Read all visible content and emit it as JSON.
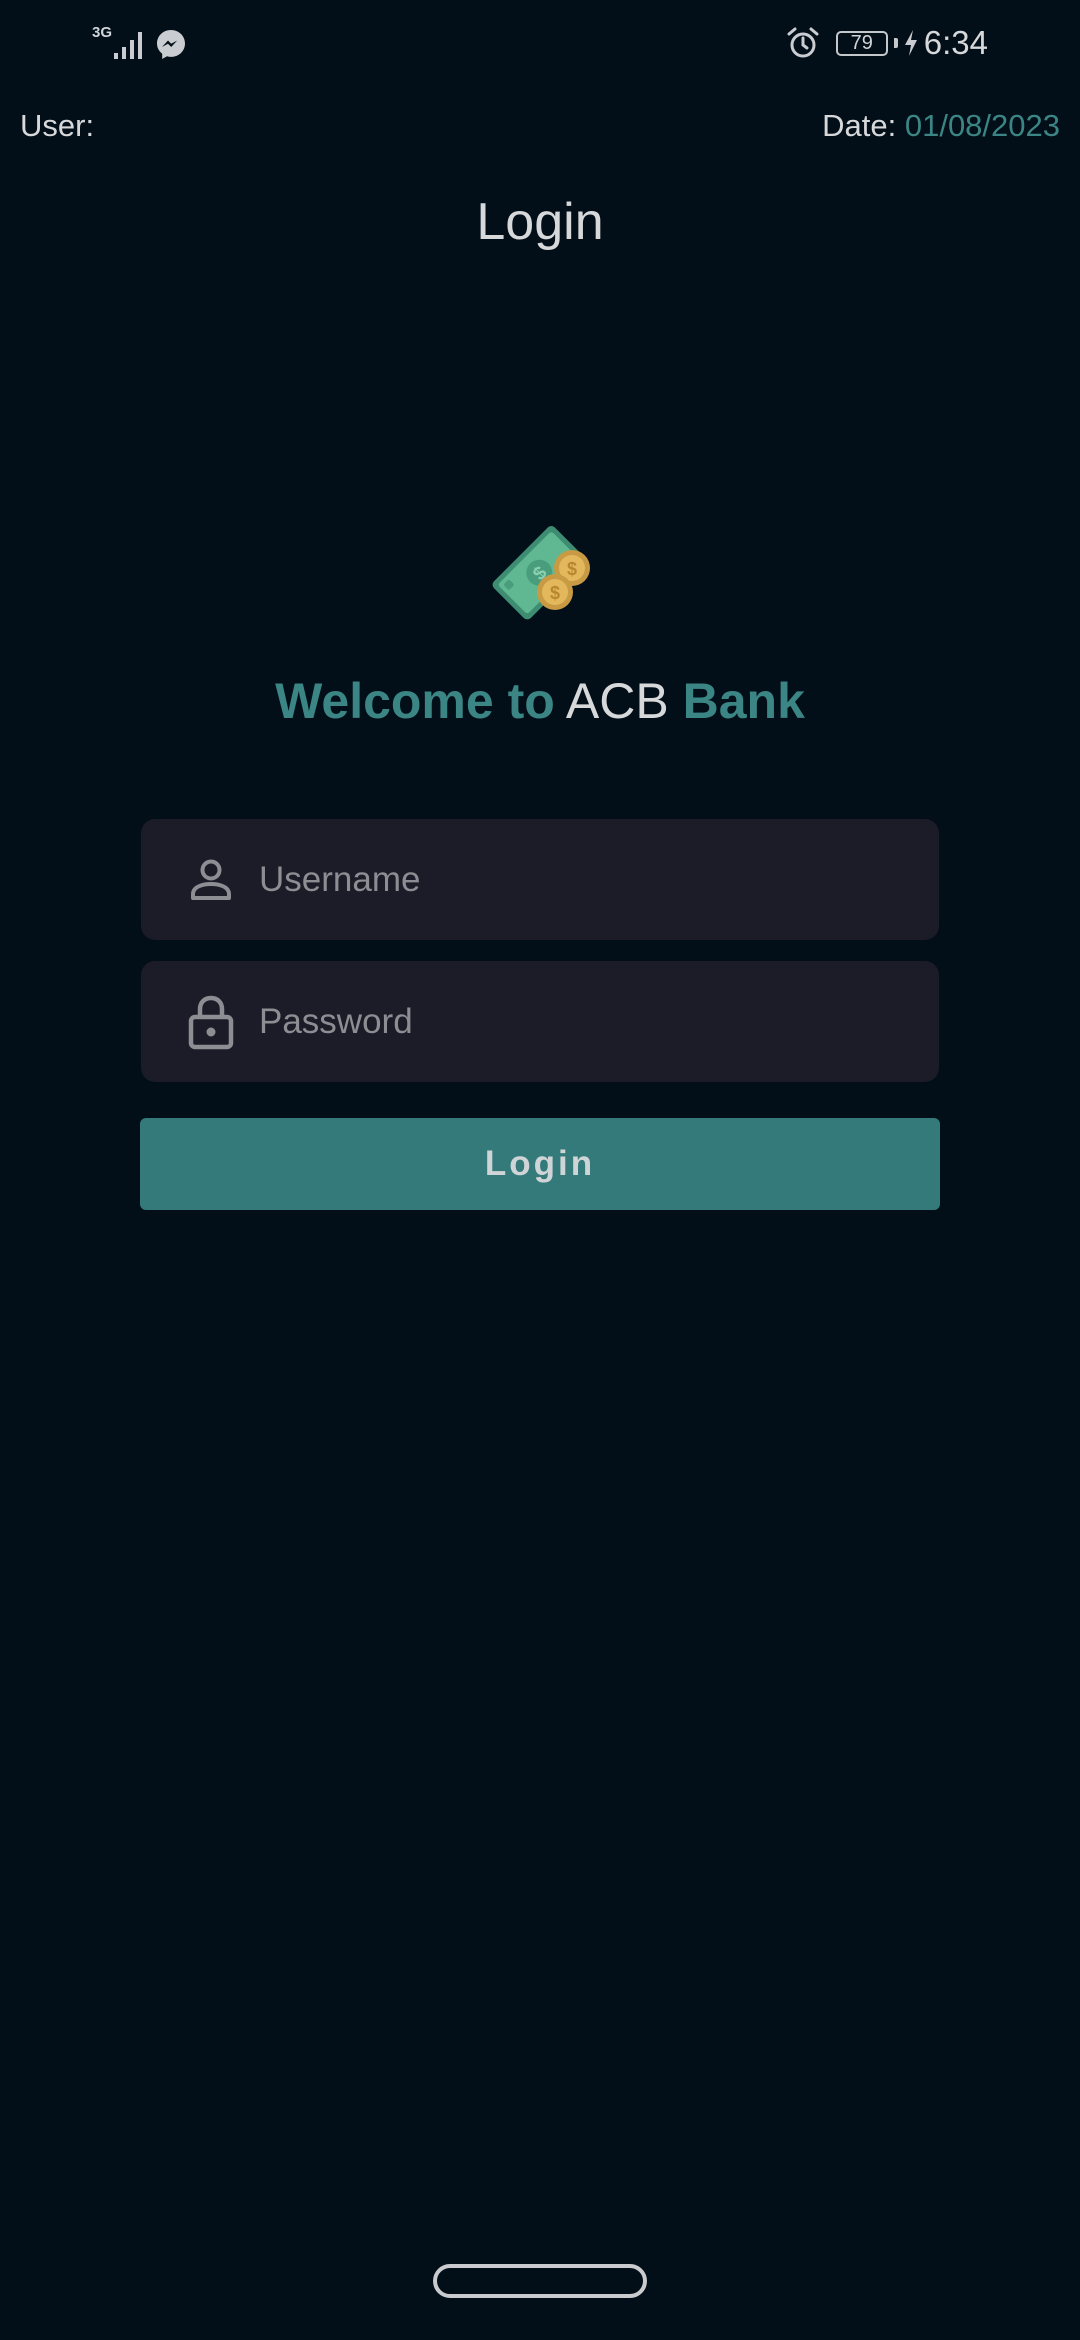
{
  "status_bar": {
    "network_type": "3G",
    "signal_icon": "signal-bars-icon",
    "notification_icon": "messenger-icon",
    "alarm_icon": "alarm-clock-icon",
    "battery_level": "79",
    "charging_icon": "lightning-bolt-icon",
    "time": "6:34"
  },
  "header": {
    "user_label": "User:",
    "date_label": "Date:",
    "date_value": "01/08/2023",
    "title": "Login"
  },
  "welcome": {
    "logo_icon": "money-bill-coins-icon",
    "part1": "Welcome to",
    "part2": "ACB",
    "part3": "Bank"
  },
  "form": {
    "username": {
      "icon": "person-icon",
      "value": "",
      "placeholder": "Username"
    },
    "password": {
      "icon": "lock-icon",
      "value": "",
      "placeholder": "Password"
    },
    "submit_label": "Login"
  },
  "colors": {
    "background": "#020e18",
    "accent": "#3b8585",
    "button": "#357a7b",
    "field_background": "#1b1c27",
    "text": "#d6d8da",
    "placeholder": "#8c8e93"
  }
}
